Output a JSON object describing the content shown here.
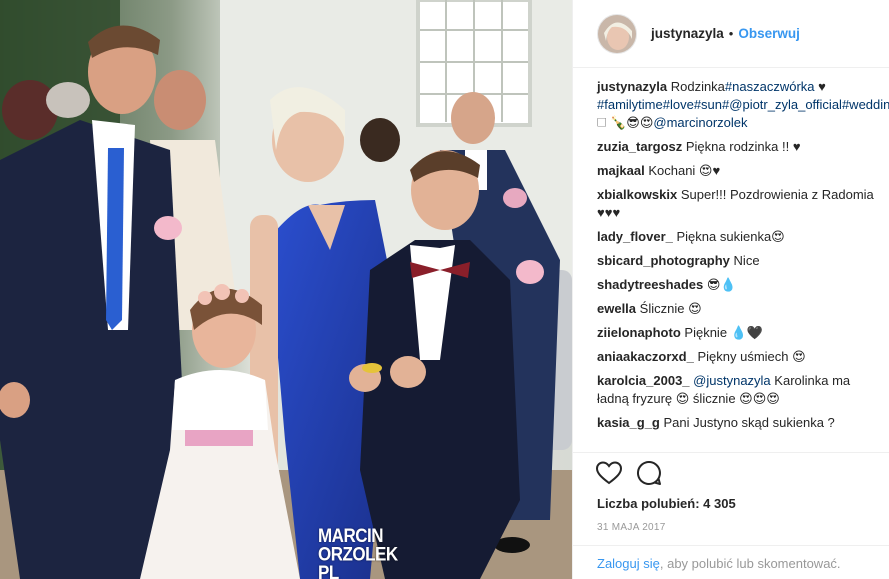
{
  "photo": {
    "alt": "",
    "watermark_line1": "MARCIN",
    "watermark_line2": "ORZOLEK",
    "watermark_line3": "PL"
  },
  "header": {
    "username": "justynazyla",
    "separator": "•",
    "follow_label": "Obserwuj"
  },
  "caption": {
    "username": "justynazyla",
    "parts": [
      {
        "text": "Rodzinka",
        "type": "text"
      },
      {
        "text": "#naszaczwórka",
        "type": "link"
      },
      {
        "text": " ♥ ",
        "type": "text"
      },
      {
        "text": "#familytime",
        "type": "link"
      },
      {
        "text": "#love",
        "type": "link"
      },
      {
        "text": "#sun",
        "type": "link"
      },
      {
        "text": "#@piotr_zyla_official",
        "type": "link"
      },
      {
        "text": "#wedding",
        "type": "link"
      },
      {
        "text": " 🗆 🍾😎😍",
        "type": "text"
      },
      {
        "text": "@marcinorzolek",
        "type": "link"
      }
    ]
  },
  "comments": [
    {
      "user": "zuzia_targosz",
      "text": "Piękna rodzinka !! ♥"
    },
    {
      "user": "majkaal",
      "text": "Kochani 😍♥"
    },
    {
      "user": "xbialkowskix",
      "text": "Super!!! Pozdrowienia z Radomia ♥♥♥"
    },
    {
      "user": "lady_flover_",
      "text": "Piękna sukienka😍"
    },
    {
      "user": "sbicard_photography",
      "text": "Nice"
    },
    {
      "user": "shadytreeshades",
      "text": "😎💧"
    },
    {
      "user": "ewella",
      "text": "Ślicznie 😍"
    },
    {
      "user": "ziielonaphoto",
      "text": "Pięknie 💧🖤"
    },
    {
      "user": "aniaakaczorxd_",
      "text": "Piękny uśmiech 😍"
    },
    {
      "user": "karolcia_2003_",
      "mention": "@justynazyla",
      "text": "Karolinka ma ładną fryzurę 😍 ślicznie 😍😍😍"
    },
    {
      "user": "kasia_g_g",
      "text": "Pani Justyno skąd sukienka ?"
    }
  ],
  "actions": {
    "like_icon": "heart-outline-icon",
    "comment_icon": "speech-bubble-icon",
    "likes_label": "Liczba polubień: 4 305",
    "date": "31 MAJA 2017"
  },
  "login": {
    "link_label": "Zaloguj się",
    "rest_text": ", aby polubić lub skomentować."
  },
  "colors": {
    "accent": "#3897f0",
    "link": "#003569",
    "muted": "#999999",
    "dress": "#1f3fa8",
    "suit": "#1c2440"
  }
}
